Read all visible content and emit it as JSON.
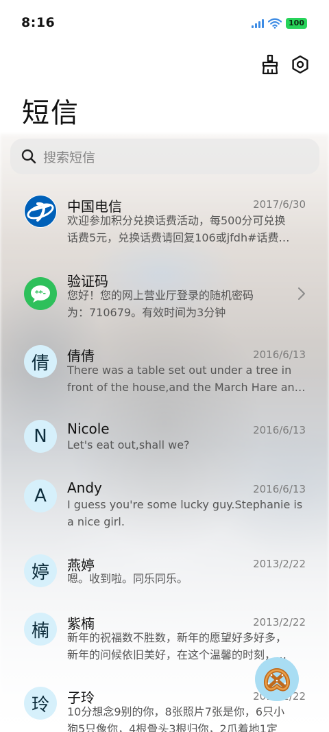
{
  "status": {
    "time": "8:16",
    "battery": "100"
  },
  "colors": {
    "accent": "#3c8be4",
    "battery": "#27d35a",
    "avatar_bg": "#d6f0fb",
    "wechat_green": "#2ec05b",
    "telecom_blue": "#0060b8"
  },
  "header": {
    "title": "短信",
    "clean_icon": "broom-icon",
    "settings_icon": "hexagon-gear-icon"
  },
  "search": {
    "placeholder": "搜索短信"
  },
  "messages": [
    {
      "avatar_type": "china-telecom-logo",
      "name": "中国电信",
      "date": "2017/6/30",
      "preview": [
        "欢迎参加积分兑换话费活动，每500分可兑换",
        "话费5元，兑换话费请回复106或jfdh#话费…"
      ]
    },
    {
      "avatar_type": "message-bubble-logo",
      "name": "验证码",
      "date": "",
      "preview": [
        "您好！您的网上营业厅登录的随机密码",
        "为：710679。有效时间为3分钟"
      ]
    },
    {
      "avatar_text": "倩",
      "name": "倩倩",
      "date": "2016/6/13",
      "preview": [
        "There was a table set out under a tree in",
        "front of the house,and the March Hare an…"
      ]
    },
    {
      "avatar_text": "N",
      "name": "Nicole",
      "date": "2016/6/13",
      "preview": [
        "Let's eat out,shall we?"
      ]
    },
    {
      "avatar_text": "A",
      "name": "Andy",
      "date": "2016/6/13",
      "preview": [
        "I guess you're some lucky guy.Stephanie is",
        "a nice girl."
      ]
    },
    {
      "avatar_text": "婷",
      "name": "燕婷",
      "date": "2013/2/22",
      "preview": [
        "嗯。收到啦。同乐同乐。"
      ]
    },
    {
      "avatar_text": "楠",
      "name": "紫楠",
      "date": "2013/2/22",
      "preview": [
        "新年的祝福数不胜数，新年的愿望好多好多，",
        "新年的问候依旧美好，在这个温馨的时刻，…"
      ]
    },
    {
      "avatar_text": "玲",
      "name": "子玲",
      "date": "2013/2/22",
      "preview": [
        "10分想念9别的你，8张照片7张是你，6只小",
        "狗5只像你，4根骨头3根归你，2爪着地1定"
      ]
    }
  ],
  "floating_button": {
    "icon": "pretzel-icon"
  }
}
